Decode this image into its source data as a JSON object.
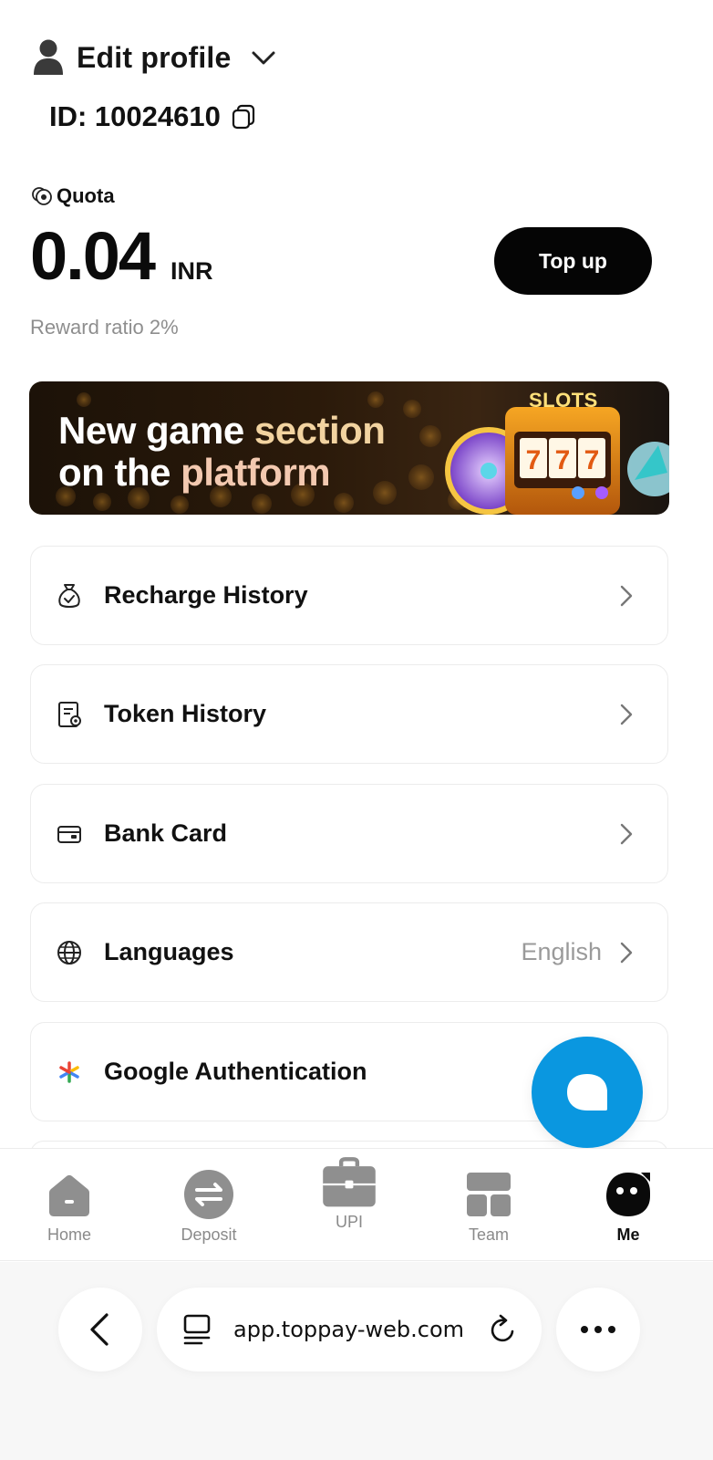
{
  "profile": {
    "name": "Edit profile",
    "id_text": "ID: 10024610"
  },
  "quota": {
    "label": "Quota",
    "amount": "0.04",
    "currency": "INR",
    "reward_ratio": "Reward ratio 2%",
    "topup_label": "Top up"
  },
  "banner": {
    "line1_a": "New game ",
    "line1_b": "section",
    "line2_a": "on the ",
    "line2_b": "platform",
    "slots_label": "SLOTS"
  },
  "menu": [
    {
      "label": "Recharge History",
      "icon": "money-bag-icon"
    },
    {
      "label": "Token History",
      "icon": "document-icon"
    },
    {
      "label": "Bank Card",
      "icon": "card-icon"
    },
    {
      "label": "Languages",
      "value": "English",
      "icon": "globe-icon"
    },
    {
      "label": "Google Authentication",
      "icon": "google-auth-icon"
    }
  ],
  "tabs": [
    {
      "label": "Home",
      "icon": "home-icon"
    },
    {
      "label": "Deposit",
      "icon": "deposit-icon"
    },
    {
      "label": "UPI",
      "icon": "briefcase-icon"
    },
    {
      "label": "Team",
      "icon": "team-icon"
    },
    {
      "label": "Me",
      "icon": "me-icon",
      "active": true
    }
  ],
  "browser": {
    "url": "app.toppay-web.com"
  },
  "colors": {
    "accent_blue": "#0a97e0",
    "primary_black": "#050505",
    "muted_gray": "#8e8e8e"
  }
}
